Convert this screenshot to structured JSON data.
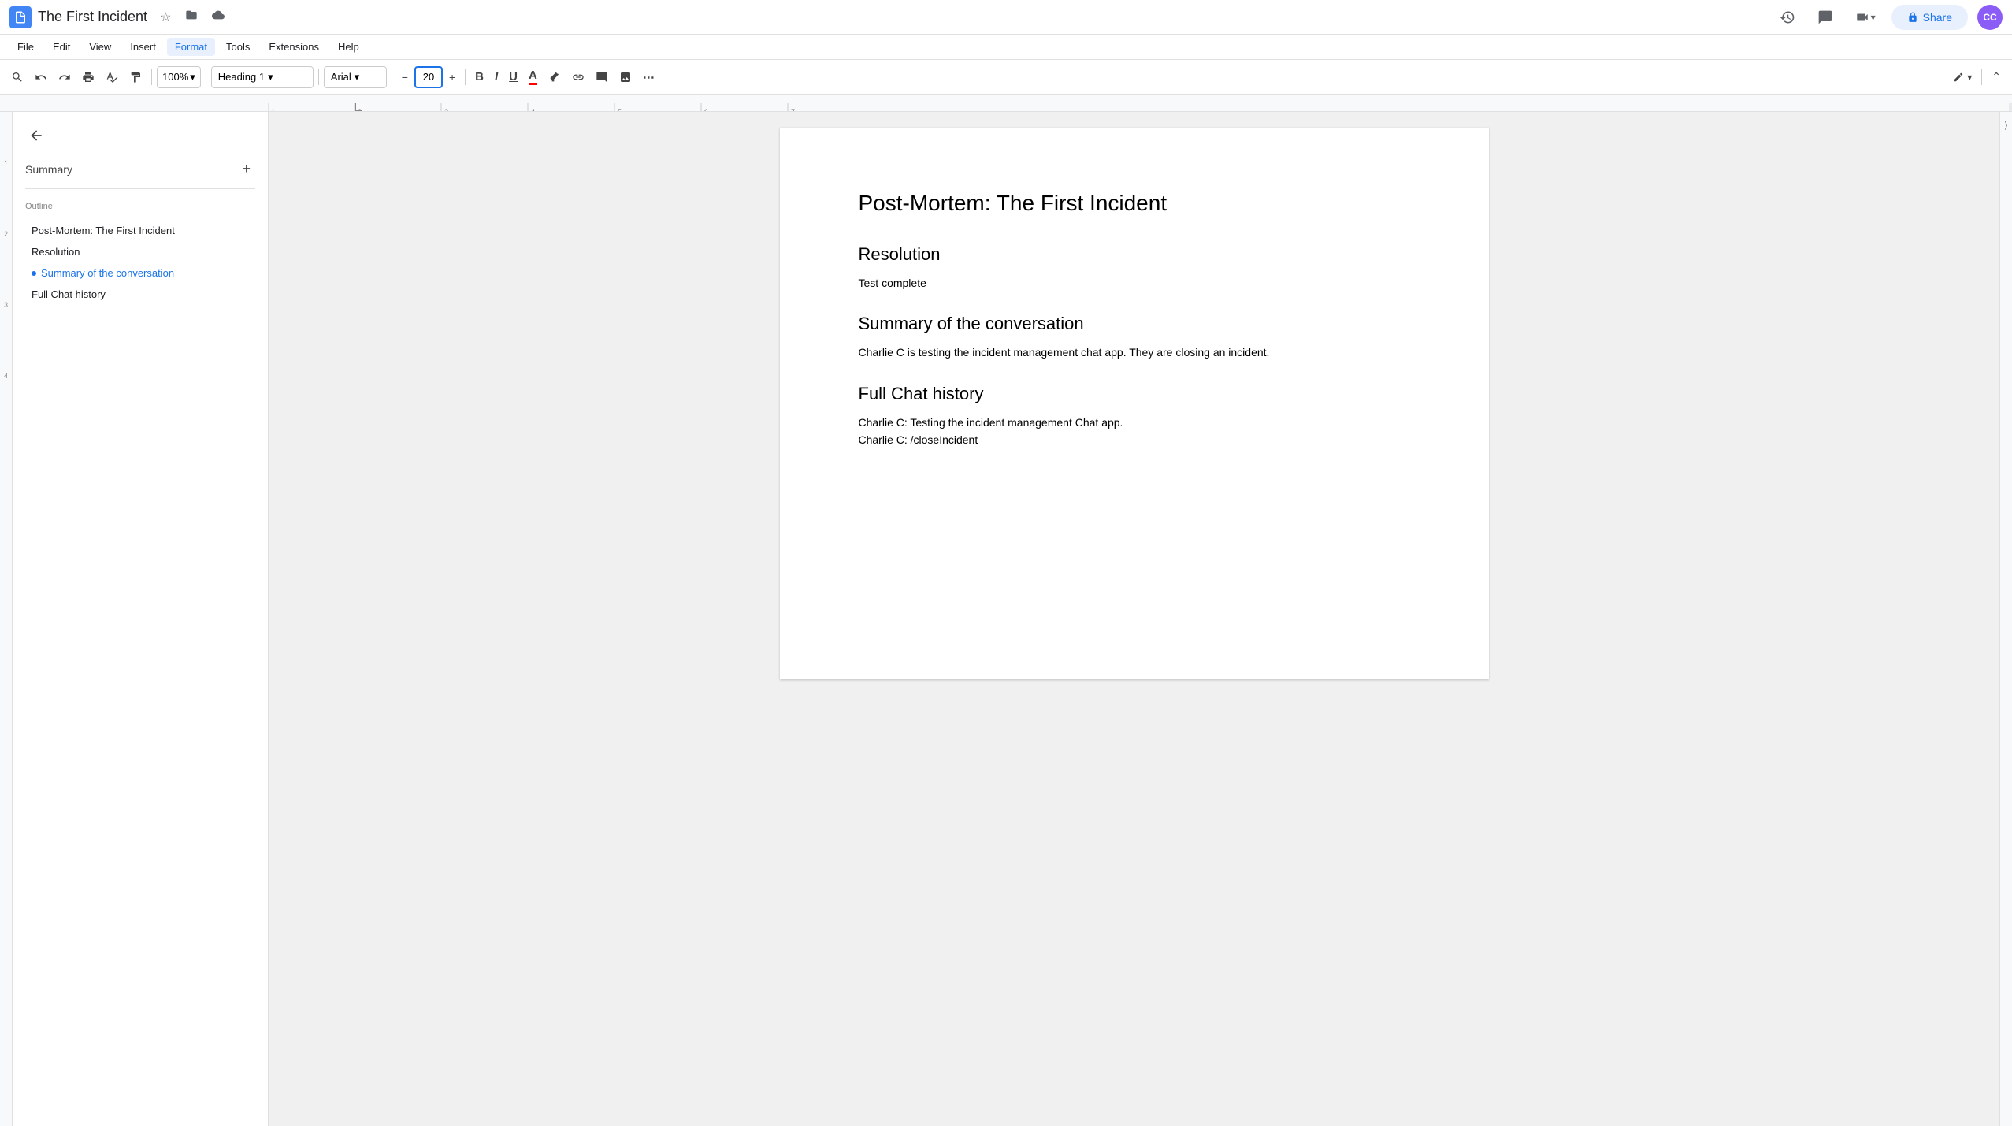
{
  "titleBar": {
    "docTitle": "The First Incident",
    "docIcon": "📄",
    "starLabel": "★",
    "folderLabel": "📁",
    "cloudLabel": "☁"
  },
  "menuBar": {
    "items": [
      "File",
      "Edit",
      "View",
      "Insert",
      "Format",
      "Tools",
      "Extensions",
      "Help"
    ],
    "activeItem": "Format"
  },
  "toolbar": {
    "searchLabel": "🔍",
    "undoLabel": "↩",
    "redoLabel": "↪",
    "printLabel": "🖨",
    "spellLabel": "✓",
    "paintLabel": "🎨",
    "zoomValue": "100%",
    "zoomDropdown": "▾",
    "styleValue": "Heading 1",
    "styleDropdown": "▾",
    "fontValue": "Arial",
    "fontDropdown": "▾",
    "fontSizeMinus": "−",
    "fontSize": "20",
    "fontSizePlus": "+",
    "boldLabel": "B",
    "italicLabel": "I",
    "underlineLabel": "U",
    "textColorLabel": "A",
    "highlightLabel": "🖊",
    "linkLabel": "🔗",
    "commentLabel": "💬",
    "imageLabel": "🖼",
    "moreLabel": "⋯",
    "editModeLabel": "✏",
    "editDropdown": "▾",
    "collapseLabel": "⌃"
  },
  "headerRight": {
    "historyIcon": "🕐",
    "commentsIcon": "💬",
    "meetIcon": "📹",
    "shareLabel": "Share",
    "lockIcon": "🔒",
    "avatarInitials": "CC"
  },
  "sidebar": {
    "backLabel": "←",
    "summaryLabel": "Summary",
    "addLabel": "+",
    "outlineLabel": "Outline",
    "outlineItems": [
      {
        "label": "Post-Mortem: The First Incident",
        "active": false
      },
      {
        "label": "Resolution",
        "active": false
      },
      {
        "label": "Summary of the conversation",
        "active": true
      },
      {
        "label": "Full Chat history",
        "active": false
      }
    ]
  },
  "document": {
    "title": "Post-Mortem: The First Incident",
    "sections": [
      {
        "heading": "Resolution",
        "content": "Test complete"
      },
      {
        "heading": "Summary of the conversation",
        "content": "Charlie C is testing the incident management chat app. They are closing an incident."
      },
      {
        "heading": "Full Chat history",
        "content": "Charlie C: Testing the incident management Chat app.\nCharlie C: /closeIncident"
      }
    ]
  },
  "leftMarginNumbers": [
    "1",
    "2",
    "3",
    "4"
  ],
  "colors": {
    "accent": "#1a73e8",
    "activeOutline": "#1a73e8"
  }
}
